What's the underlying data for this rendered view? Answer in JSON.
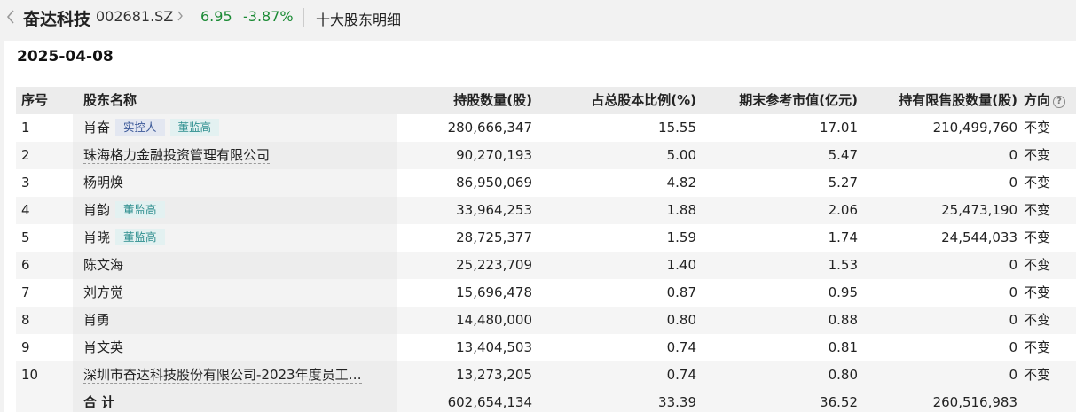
{
  "header": {
    "back_icon": "chevron-left-icon",
    "stock_name": "奋达科技",
    "stock_code": "002681.SZ",
    "chevron": "›",
    "price": "6.95",
    "change": "-3.87%",
    "page_title": "十大股东明细",
    "price_color": "#1a8a34"
  },
  "report_date": "2025-04-08",
  "columns": {
    "idx": "序号",
    "name": "股东名称",
    "holding": "持股数量(股)",
    "pct": "占总股本比例(%)",
    "market_value": "期末参考市值(亿元)",
    "restricted": "持有限售股数量(股)",
    "direction": "方向"
  },
  "rows": [
    {
      "idx": "1",
      "name": "肖奋",
      "tags": [
        "实控人",
        "董监高"
      ],
      "holding": "280,666,347",
      "pct": "15.55",
      "mv": "17.01",
      "restricted": "210,499,760",
      "dir": "不变"
    },
    {
      "idx": "2",
      "name": "珠海格力金融投资管理有限公司",
      "tags": [],
      "holding": "90,270,193",
      "pct": "5.00",
      "mv": "5.47",
      "restricted": "0",
      "dir": "不变"
    },
    {
      "idx": "3",
      "name": "杨明焕",
      "tags": [],
      "holding": "86,950,069",
      "pct": "4.82",
      "mv": "5.27",
      "restricted": "0",
      "dir": "不变"
    },
    {
      "idx": "4",
      "name": "肖韵",
      "tags": [
        "董监高"
      ],
      "holding": "33,964,253",
      "pct": "1.88",
      "mv": "2.06",
      "restricted": "25,473,190",
      "dir": "不变"
    },
    {
      "idx": "5",
      "name": "肖晓",
      "tags": [
        "董监高"
      ],
      "holding": "28,725,377",
      "pct": "1.59",
      "mv": "1.74",
      "restricted": "24,544,033",
      "dir": "不变"
    },
    {
      "idx": "6",
      "name": "陈文海",
      "tags": [],
      "holding": "25,223,709",
      "pct": "1.40",
      "mv": "1.53",
      "restricted": "0",
      "dir": "不变"
    },
    {
      "idx": "7",
      "name": "刘方觉",
      "tags": [],
      "holding": "15,696,478",
      "pct": "0.87",
      "mv": "0.95",
      "restricted": "0",
      "dir": "不变"
    },
    {
      "idx": "8",
      "name": "肖勇",
      "tags": [],
      "holding": "14,480,000",
      "pct": "0.80",
      "mv": "0.88",
      "restricted": "0",
      "dir": "不变"
    },
    {
      "idx": "9",
      "name": "肖文英",
      "tags": [],
      "holding": "13,404,503",
      "pct": "0.74",
      "mv": "0.81",
      "restricted": "0",
      "dir": "不变"
    },
    {
      "idx": "10",
      "name": "深圳市奋达科技股份有限公司-2023年度员工…",
      "tags": [],
      "holding": "13,273,205",
      "pct": "0.74",
      "mv": "0.80",
      "restricted": "0",
      "dir": "不变"
    }
  ],
  "total": {
    "label": "合 计",
    "holding": "602,654,134",
    "pct": "33.39",
    "mv": "36.52",
    "restricted": "260,516,983"
  }
}
